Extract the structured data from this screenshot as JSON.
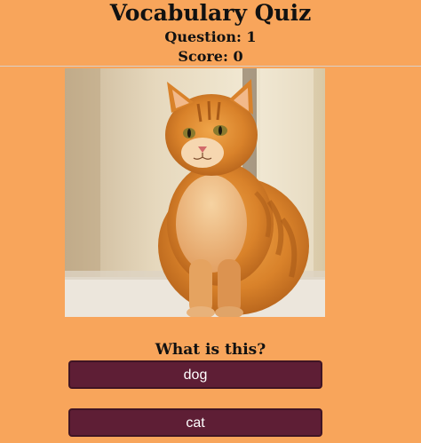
{
  "header": {
    "title": "Vocabulary Quiz",
    "question": "Question: 1",
    "score": "Score: 0"
  },
  "main": {
    "image_subject": "orange tabby cat",
    "prompt": "What is this?",
    "answers": [
      {
        "label": "dog"
      },
      {
        "label": "cat"
      }
    ]
  },
  "colors": {
    "background": "#F8A55B",
    "button": "#5E1E35",
    "button_text": "#FFFFFF"
  }
}
